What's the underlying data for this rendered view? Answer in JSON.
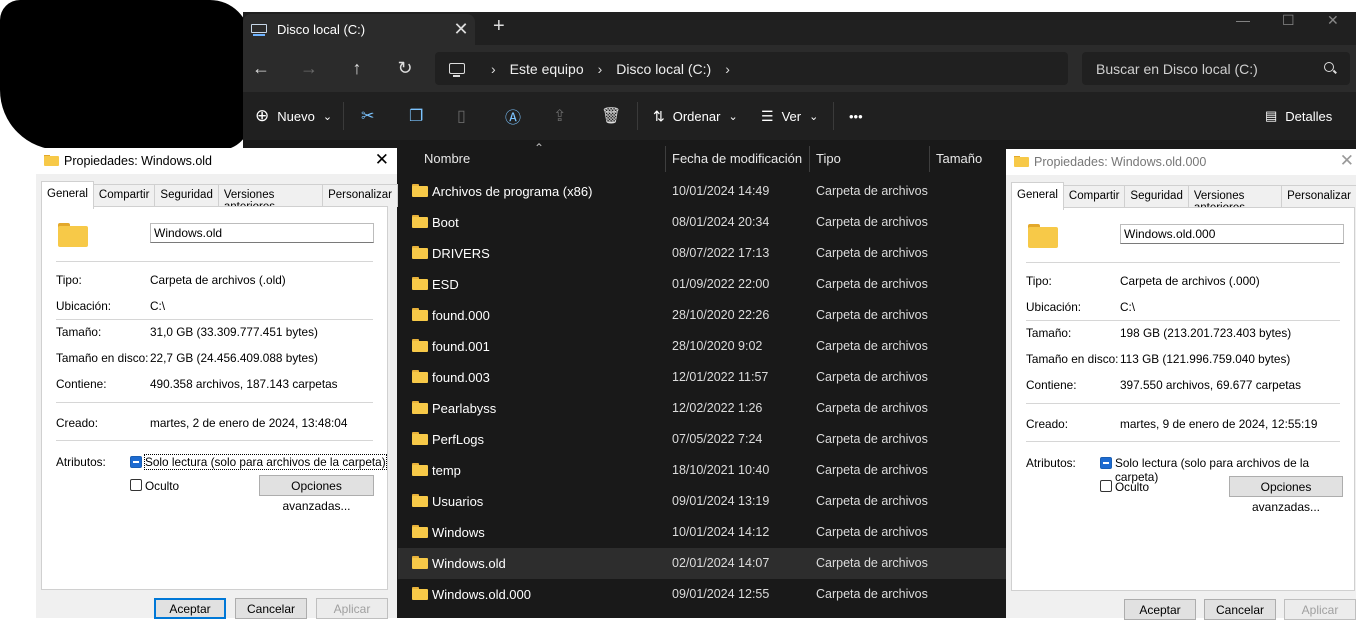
{
  "explorer": {
    "tab_title": "Disco local (C:)",
    "tab_close": "✕",
    "new_tab": "+",
    "window_controls": {
      "minimize": "—",
      "maximize": "☐",
      "close": "✕"
    },
    "nav": {
      "back": "←",
      "forward": "→",
      "up": "↑",
      "refresh": "↻"
    },
    "breadcrumb": {
      "chevron": "›",
      "items": [
        "Este equipo",
        "Disco local (C:)"
      ]
    },
    "search_placeholder": "Buscar en Disco local (C:)",
    "toolbar": {
      "new_label": "Nuevo",
      "sort_label": "Ordenar",
      "view_label": "Ver",
      "more": "•••",
      "details_label": "Detalles",
      "caret": "⌄"
    },
    "columns": {
      "name": "Nombre",
      "modified": "Fecha de modificación",
      "type": "Tipo",
      "size": "Tamaño",
      "sort_indicator": "⌃"
    },
    "files": [
      {
        "name": "Archivos de programa (x86)",
        "date": "10/01/2024 14:49",
        "type": "Carpeta de archivos",
        "selected": false
      },
      {
        "name": "Boot",
        "date": "08/01/2024 20:34",
        "type": "Carpeta de archivos",
        "selected": false
      },
      {
        "name": "DRIVERS",
        "date": "08/07/2022 17:13",
        "type": "Carpeta de archivos",
        "selected": false
      },
      {
        "name": "ESD",
        "date": "01/09/2022 22:00",
        "type": "Carpeta de archivos",
        "selected": false
      },
      {
        "name": "found.000",
        "date": "28/10/2020 22:26",
        "type": "Carpeta de archivos",
        "selected": false
      },
      {
        "name": "found.001",
        "date": "28/10/2020 9:02",
        "type": "Carpeta de archivos",
        "selected": false
      },
      {
        "name": "found.003",
        "date": "12/01/2022 11:57",
        "type": "Carpeta de archivos",
        "selected": false
      },
      {
        "name": "Pearlabyss",
        "date": "12/02/2022 1:26",
        "type": "Carpeta de archivos",
        "selected": false
      },
      {
        "name": "PerfLogs",
        "date": "07/05/2022 7:24",
        "type": "Carpeta de archivos",
        "selected": false
      },
      {
        "name": "temp",
        "date": "18/10/2021 10:40",
        "type": "Carpeta de archivos",
        "selected": false
      },
      {
        "name": "Usuarios",
        "date": "09/01/2024 13:19",
        "type": "Carpeta de archivos",
        "selected": false
      },
      {
        "name": "Windows",
        "date": "10/01/2024 14:12",
        "type": "Carpeta de archivos",
        "selected": false
      },
      {
        "name": "Windows.old",
        "date": "02/01/2024 14:07",
        "type": "Carpeta de archivos",
        "selected": true
      },
      {
        "name": "Windows.old.000",
        "date": "09/01/2024 12:55",
        "type": "Carpeta de archivos",
        "selected": false
      }
    ]
  },
  "dialog_left": {
    "title": "Propiedades: Windows.old",
    "close": "✕",
    "tabs": [
      "General",
      "Compartir",
      "Seguridad",
      "Versiones anteriores",
      "Personalizar"
    ],
    "folder_name": "Windows.old",
    "props": {
      "tipo_label": "Tipo:",
      "tipo": "Carpeta de archivos (.old)",
      "ubicacion_label": "Ubicación:",
      "ubicacion": "C:\\",
      "tamano_label": "Tamaño:",
      "tamano": "31,0 GB (33.309.777.451 bytes)",
      "tamano_disco_label": "Tamaño en disco:",
      "tamano_disco": "22,7 GB (24.456.409.088 bytes)",
      "contiene_label": "Contiene:",
      "contiene": "490.358 archivos, 187.143 carpetas",
      "creado_label": "Creado:",
      "creado": "martes, 2 de enero de 2024, 13:48:04",
      "atributos_label": "Atributos:",
      "solo_lectura": "Solo lectura (solo para archivos de la carpeta)",
      "oculto": "Oculto",
      "avanzadas": "Opciones avanzadas..."
    },
    "buttons": {
      "ok": "Aceptar",
      "cancel": "Cancelar",
      "apply": "Aplicar"
    }
  },
  "dialog_right": {
    "title": "Propiedades: Windows.old.000",
    "close": "✕",
    "tabs": [
      "General",
      "Compartir",
      "Seguridad",
      "Versiones anteriores",
      "Personalizar"
    ],
    "folder_name": "Windows.old.000",
    "props": {
      "tipo_label": "Tipo:",
      "tipo": "Carpeta de archivos (.000)",
      "ubicacion_label": "Ubicación:",
      "ubicacion": "C:\\",
      "tamano_label": "Tamaño:",
      "tamano": "198 GB (213.201.723.403 bytes)",
      "tamano_disco_label": "Tamaño en disco:",
      "tamano_disco": "113 GB (121.996.759.040 bytes)",
      "contiene_label": "Contiene:",
      "contiene": "397.550 archivos, 69.677 carpetas",
      "creado_label": "Creado:",
      "creado": "martes, 9 de enero de 2024, 12:55:19",
      "atributos_label": "Atributos:",
      "solo_lectura": "Solo lectura (solo para archivos de la carpeta)",
      "oculto": "Oculto",
      "avanzadas": "Opciones avanzadas..."
    },
    "buttons": {
      "ok": "Aceptar",
      "cancel": "Cancelar",
      "apply": "Aplicar"
    }
  }
}
